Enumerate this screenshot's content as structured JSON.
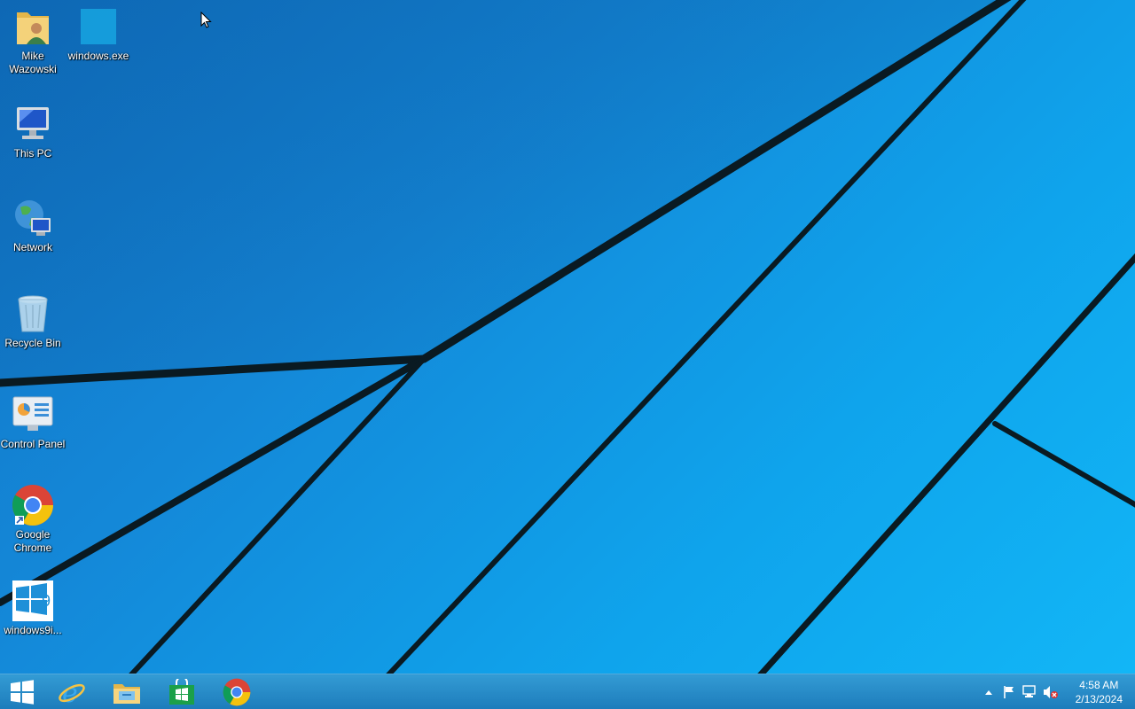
{
  "desktop": {
    "icons": [
      {
        "label": "Mike Wazowski",
        "icon": "user-folder-icon"
      },
      {
        "label": "windows.exe",
        "icon": "blank-app-icon"
      },
      {
        "label": "This PC",
        "icon": "computer-icon"
      },
      {
        "label": "Network",
        "icon": "network-icon"
      },
      {
        "label": "Recycle Bin",
        "icon": "recycle-bin-icon"
      },
      {
        "label": "Control Panel",
        "icon": "control-panel-icon"
      },
      {
        "label": "Google Chrome",
        "icon": "chrome-icon"
      },
      {
        "label": "windows9i...",
        "icon": "windows9-installer-icon"
      }
    ]
  },
  "taskbar": {
    "start": {
      "icon": "windows-logo-icon"
    },
    "pinned": [
      {
        "icon": "internet-explorer-icon"
      },
      {
        "icon": "file-explorer-icon"
      },
      {
        "icon": "store-icon"
      },
      {
        "icon": "chrome-icon"
      }
    ],
    "tray": {
      "icons": [
        "show-hidden-icons-arrow-icon",
        "action-center-flag-icon",
        "network-status-icon",
        "volume-muted-icon"
      ],
      "time": "4:58 AM",
      "date": "2/13/2024"
    }
  },
  "colors": {
    "wallpaper_dark": "#1173c4",
    "wallpaper_light": "#12b6f6",
    "taskbar": "#1f8ccb",
    "stripe": "#0a1a22"
  }
}
